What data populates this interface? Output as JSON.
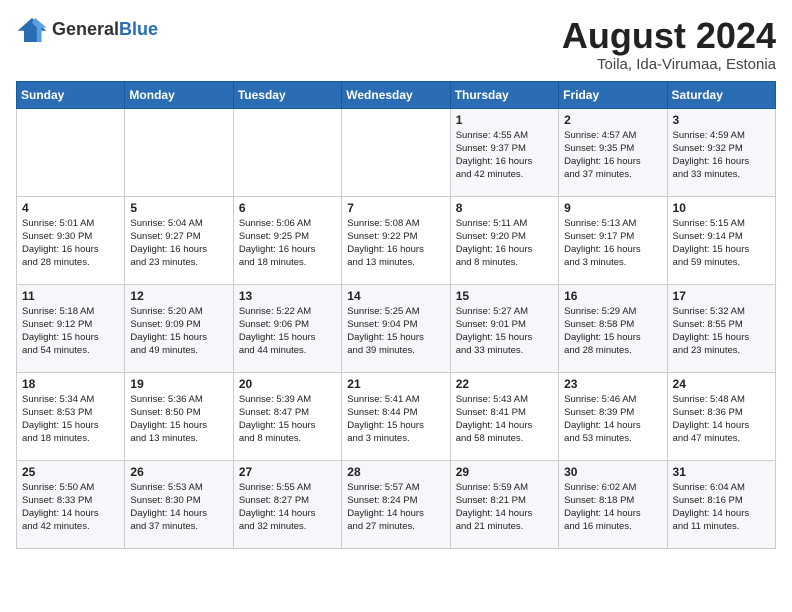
{
  "header": {
    "logo_general": "General",
    "logo_blue": "Blue",
    "month_year": "August 2024",
    "location": "Toila, Ida-Virumaa, Estonia"
  },
  "weekdays": [
    "Sunday",
    "Monday",
    "Tuesday",
    "Wednesday",
    "Thursday",
    "Friday",
    "Saturday"
  ],
  "weeks": [
    [
      {
        "day": "",
        "info": ""
      },
      {
        "day": "",
        "info": ""
      },
      {
        "day": "",
        "info": ""
      },
      {
        "day": "",
        "info": ""
      },
      {
        "day": "1",
        "info": "Sunrise: 4:55 AM\nSunset: 9:37 PM\nDaylight: 16 hours\nand 42 minutes."
      },
      {
        "day": "2",
        "info": "Sunrise: 4:57 AM\nSunset: 9:35 PM\nDaylight: 16 hours\nand 37 minutes."
      },
      {
        "day": "3",
        "info": "Sunrise: 4:59 AM\nSunset: 9:32 PM\nDaylight: 16 hours\nand 33 minutes."
      }
    ],
    [
      {
        "day": "4",
        "info": "Sunrise: 5:01 AM\nSunset: 9:30 PM\nDaylight: 16 hours\nand 28 minutes."
      },
      {
        "day": "5",
        "info": "Sunrise: 5:04 AM\nSunset: 9:27 PM\nDaylight: 16 hours\nand 23 minutes."
      },
      {
        "day": "6",
        "info": "Sunrise: 5:06 AM\nSunset: 9:25 PM\nDaylight: 16 hours\nand 18 minutes."
      },
      {
        "day": "7",
        "info": "Sunrise: 5:08 AM\nSunset: 9:22 PM\nDaylight: 16 hours\nand 13 minutes."
      },
      {
        "day": "8",
        "info": "Sunrise: 5:11 AM\nSunset: 9:20 PM\nDaylight: 16 hours\nand 8 minutes."
      },
      {
        "day": "9",
        "info": "Sunrise: 5:13 AM\nSunset: 9:17 PM\nDaylight: 16 hours\nand 3 minutes."
      },
      {
        "day": "10",
        "info": "Sunrise: 5:15 AM\nSunset: 9:14 PM\nDaylight: 15 hours\nand 59 minutes."
      }
    ],
    [
      {
        "day": "11",
        "info": "Sunrise: 5:18 AM\nSunset: 9:12 PM\nDaylight: 15 hours\nand 54 minutes."
      },
      {
        "day": "12",
        "info": "Sunrise: 5:20 AM\nSunset: 9:09 PM\nDaylight: 15 hours\nand 49 minutes."
      },
      {
        "day": "13",
        "info": "Sunrise: 5:22 AM\nSunset: 9:06 PM\nDaylight: 15 hours\nand 44 minutes."
      },
      {
        "day": "14",
        "info": "Sunrise: 5:25 AM\nSunset: 9:04 PM\nDaylight: 15 hours\nand 39 minutes."
      },
      {
        "day": "15",
        "info": "Sunrise: 5:27 AM\nSunset: 9:01 PM\nDaylight: 15 hours\nand 33 minutes."
      },
      {
        "day": "16",
        "info": "Sunrise: 5:29 AM\nSunset: 8:58 PM\nDaylight: 15 hours\nand 28 minutes."
      },
      {
        "day": "17",
        "info": "Sunrise: 5:32 AM\nSunset: 8:55 PM\nDaylight: 15 hours\nand 23 minutes."
      }
    ],
    [
      {
        "day": "18",
        "info": "Sunrise: 5:34 AM\nSunset: 8:53 PM\nDaylight: 15 hours\nand 18 minutes."
      },
      {
        "day": "19",
        "info": "Sunrise: 5:36 AM\nSunset: 8:50 PM\nDaylight: 15 hours\nand 13 minutes."
      },
      {
        "day": "20",
        "info": "Sunrise: 5:39 AM\nSunset: 8:47 PM\nDaylight: 15 hours\nand 8 minutes."
      },
      {
        "day": "21",
        "info": "Sunrise: 5:41 AM\nSunset: 8:44 PM\nDaylight: 15 hours\nand 3 minutes."
      },
      {
        "day": "22",
        "info": "Sunrise: 5:43 AM\nSunset: 8:41 PM\nDaylight: 14 hours\nand 58 minutes."
      },
      {
        "day": "23",
        "info": "Sunrise: 5:46 AM\nSunset: 8:39 PM\nDaylight: 14 hours\nand 53 minutes."
      },
      {
        "day": "24",
        "info": "Sunrise: 5:48 AM\nSunset: 8:36 PM\nDaylight: 14 hours\nand 47 minutes."
      }
    ],
    [
      {
        "day": "25",
        "info": "Sunrise: 5:50 AM\nSunset: 8:33 PM\nDaylight: 14 hours\nand 42 minutes."
      },
      {
        "day": "26",
        "info": "Sunrise: 5:53 AM\nSunset: 8:30 PM\nDaylight: 14 hours\nand 37 minutes."
      },
      {
        "day": "27",
        "info": "Sunrise: 5:55 AM\nSunset: 8:27 PM\nDaylight: 14 hours\nand 32 minutes."
      },
      {
        "day": "28",
        "info": "Sunrise: 5:57 AM\nSunset: 8:24 PM\nDaylight: 14 hours\nand 27 minutes."
      },
      {
        "day": "29",
        "info": "Sunrise: 5:59 AM\nSunset: 8:21 PM\nDaylight: 14 hours\nand 21 minutes."
      },
      {
        "day": "30",
        "info": "Sunrise: 6:02 AM\nSunset: 8:18 PM\nDaylight: 14 hours\nand 16 minutes."
      },
      {
        "day": "31",
        "info": "Sunrise: 6:04 AM\nSunset: 8:16 PM\nDaylight: 14 hours\nand 11 minutes."
      }
    ]
  ]
}
